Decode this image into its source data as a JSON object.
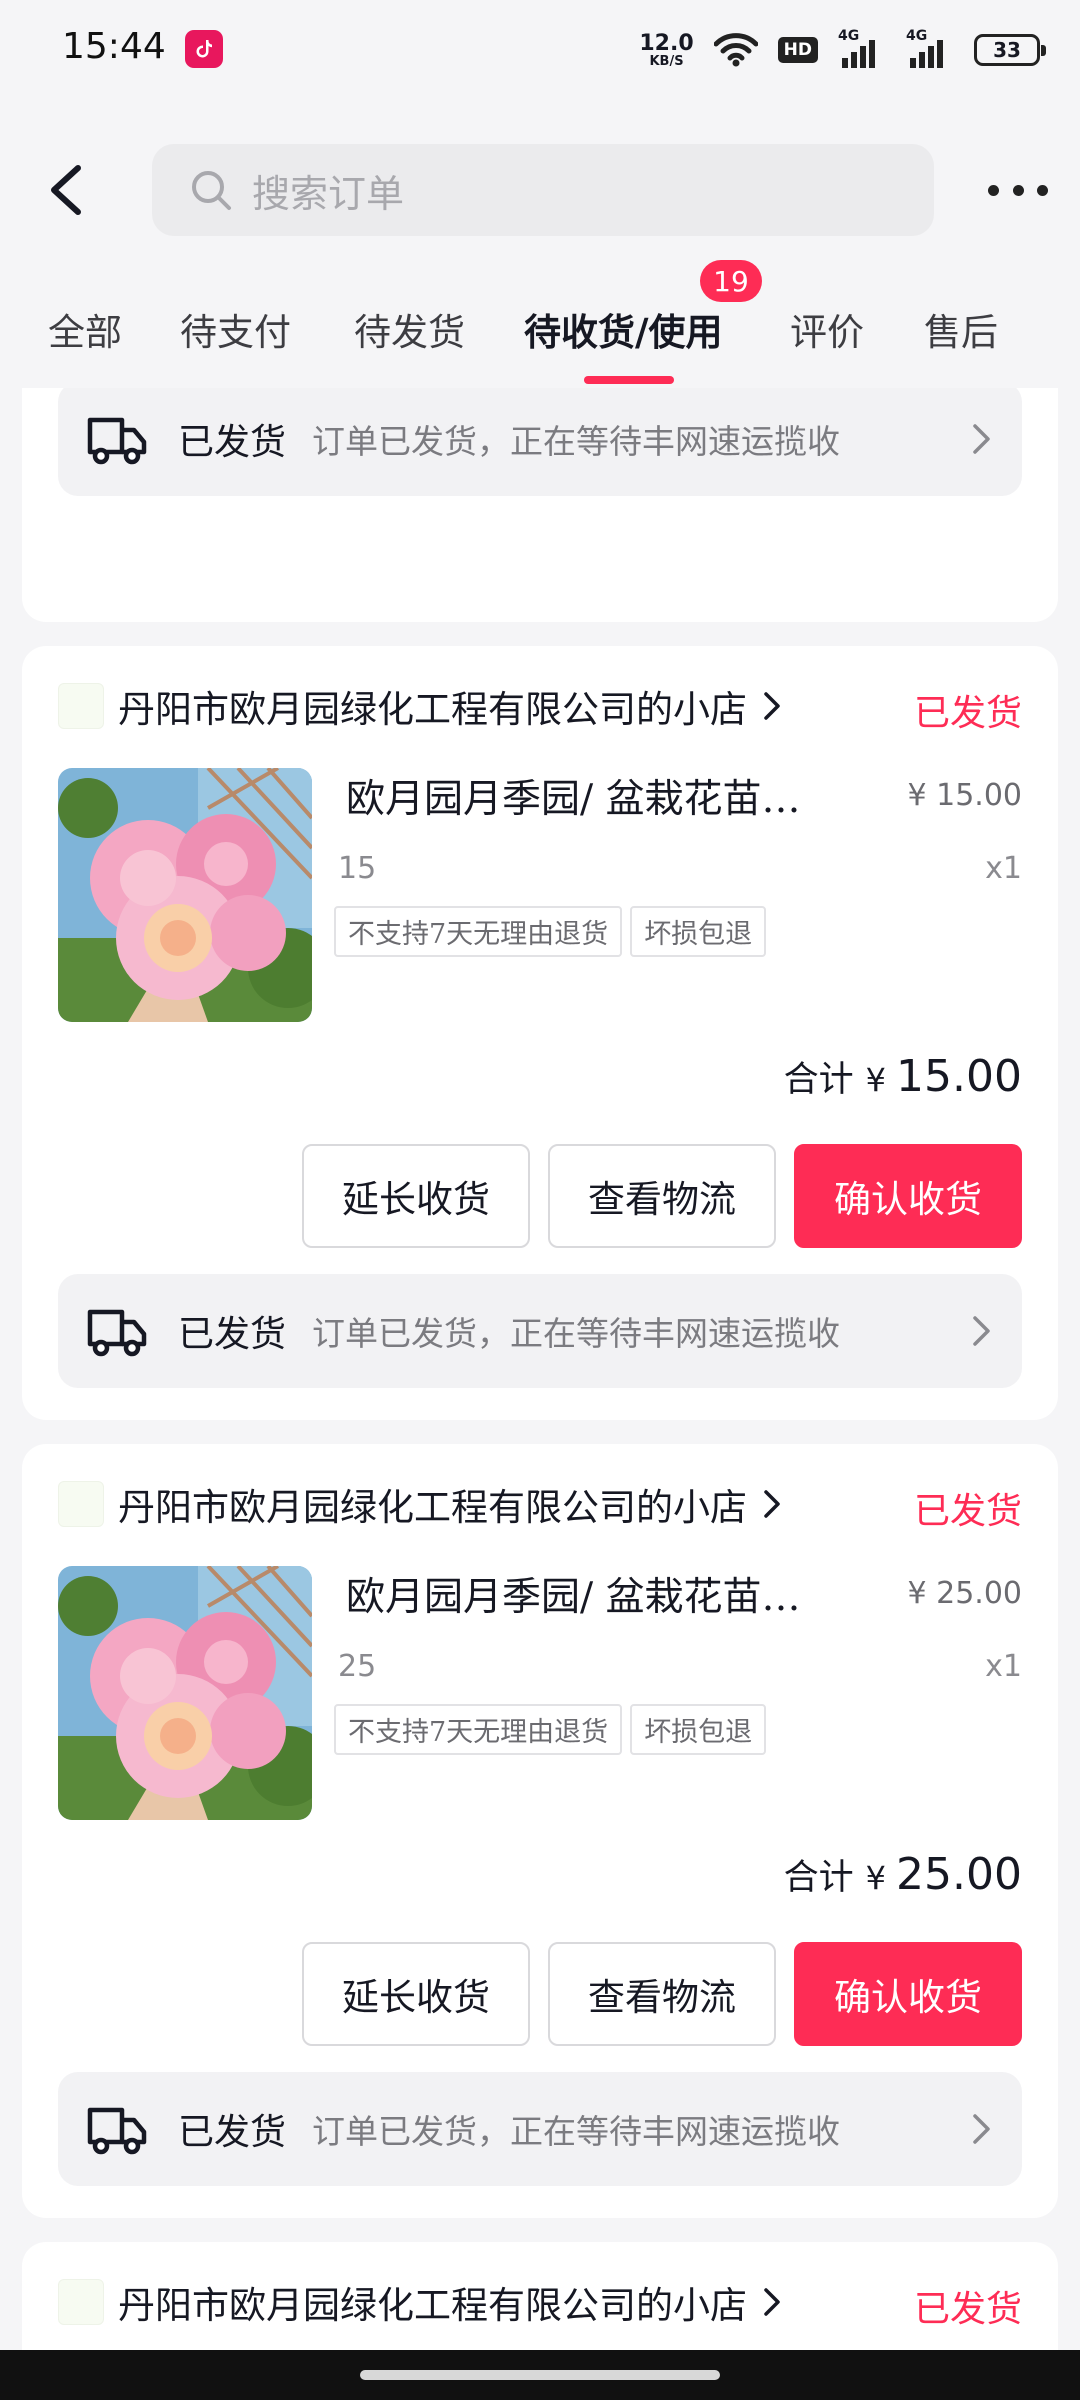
{
  "status_bar": {
    "time": "15:44",
    "net_speed_value": "12.0",
    "net_speed_unit": "KB/S",
    "hd_label": "HD",
    "signal_label_1": "4G",
    "signal_label_2": "4G",
    "battery": "33"
  },
  "header": {
    "search_placeholder": "搜索订单"
  },
  "tabs": [
    {
      "label": "全部"
    },
    {
      "label": "待支付"
    },
    {
      "label": "待发货"
    },
    {
      "label": "待收货/使用",
      "badge": "19",
      "active": true
    },
    {
      "label": "评价"
    },
    {
      "label": "售后"
    }
  ],
  "actions": {
    "extend": "延长收货",
    "logistics": "查看物流",
    "confirm": "确认收货"
  },
  "shipping": {
    "status": "已发货",
    "desc": "订单已发货，正在等待丰网速运揽收"
  },
  "total_label": "合计",
  "currency": "¥",
  "orders": [
    {
      "shop_name": "丹阳市欧月园绿化工程有限公司的小店",
      "status": "已发货",
      "product_title": "欧月园月季园/ 盆栽花苗…",
      "price": "¥ 15.00",
      "spec": "15",
      "qty": "x1",
      "tags": [
        "不支持7天无理由退货",
        "坏损包退"
      ],
      "total": "15.00"
    },
    {
      "shop_name": "丹阳市欧月园绿化工程有限公司的小店",
      "status": "已发货",
      "product_title": "欧月园月季园/ 盆栽花苗…",
      "price": "¥ 25.00",
      "spec": "25",
      "qty": "x1",
      "tags": [
        "不支持7天无理由退货",
        "坏损包退"
      ],
      "total": "25.00"
    },
    {
      "shop_name": "丹阳市欧月园绿化工程有限公司的小店",
      "status": "已发货"
    }
  ],
  "colors": {
    "accent": "#fe2c55",
    "background": "#f5f5f7"
  }
}
